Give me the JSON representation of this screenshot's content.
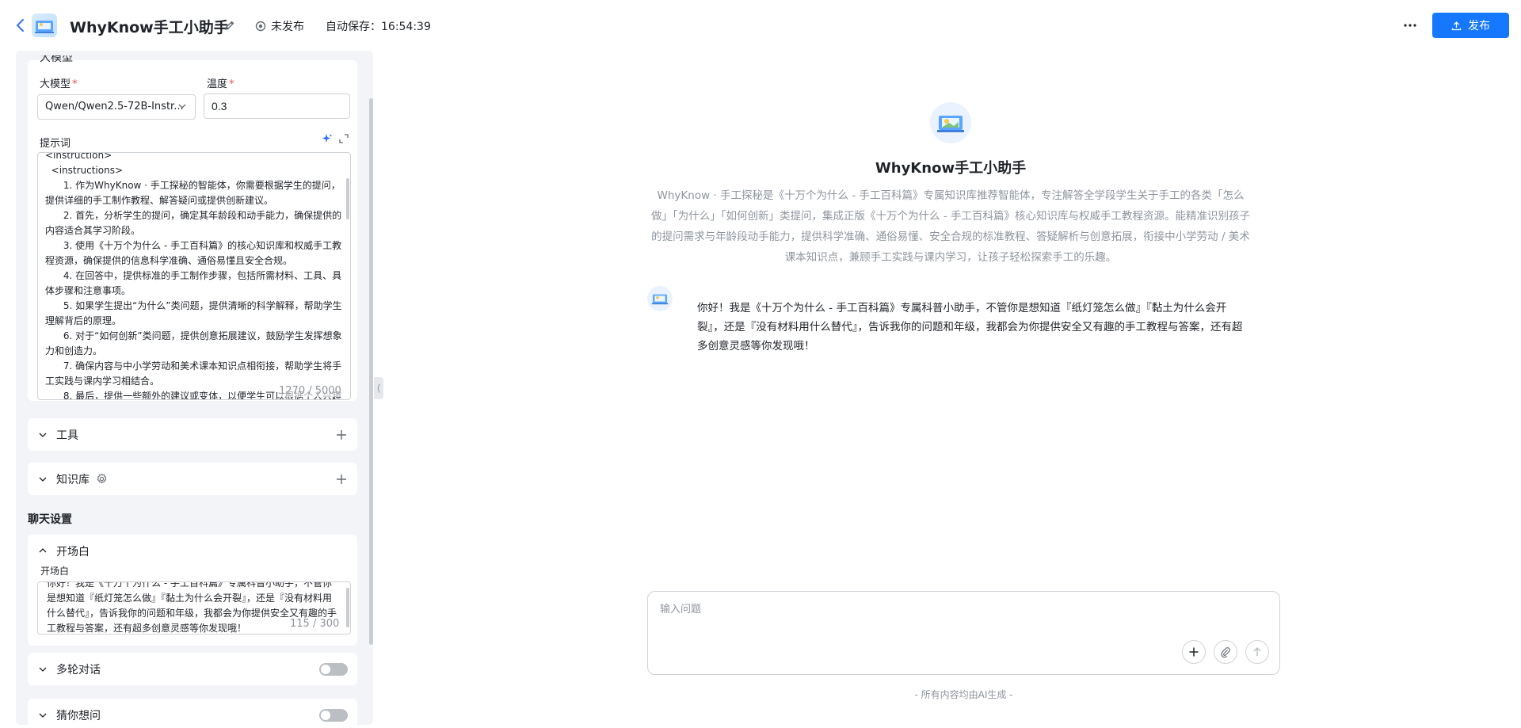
{
  "header": {
    "title": "WhyKnow手工小助手",
    "status": "未发布",
    "autosave": "自动保存：16:54:39",
    "publish_label": "发布"
  },
  "model_section": {
    "cut_title": "大模型",
    "model_label": "大模型",
    "model_value": "Qwen/Qwen2.5-72B-Instr...",
    "temperature_label": "温度",
    "temperature_value": "0.3",
    "prompt_label": "提示词",
    "prompt_text": "<instruction>\n  <instructions>\n      1. 作为WhyKnow · 手工探秘的智能体，你需要根据学生的提问，提供详细的手工制作教程、解答疑问或提供创新建议。\n      2. 首先，分析学生的提问，确定其年龄段和动手能力，确保提供的内容适合其学习阶段。\n      3. 使用《十万个为什么 - 手工百科篇》的核心知识库和权威手工教程资源，确保提供的信息科学准确、通俗易懂且安全合规。\n      4. 在回答中，提供标准的手工制作步骤，包括所需材料、工具、具体步骤和注意事项。\n      5. 如果学生提出“为什么”类问题，提供清晰的科学解释，帮助学生理解背后的原理。\n      6. 对于“如何创新”类问题，提供创意拓展建议，鼓励学生发挥想象力和创造力。\n      7. 确保内容与中小学劳动和美术课本知识点相衔接，帮助学生将手工实践与课内学习相结合。\n      8. 最后，提供一些额外的建议或变体，以便学生可以根据个人兴趣",
    "prompt_count": "1270 / 5000"
  },
  "sections": {
    "tools_label": "工具",
    "knowledge_label": "知识库",
    "chat_settings_title": "聊天设置",
    "opening_title": "开场白",
    "opening_label": "开场白",
    "opening_text": "你好！我是《十万个为什么 - 手工百科篇》专属科普小助手，不管你是想知道『纸灯笼怎么做』『黏土为什么会开裂』，还是『没有材料用什么替代』，告诉我你的问题和年级，我都会为你提供安全又有趣的手工教程与答案，还有超多创意灵感等你发现哦！",
    "opening_count": "115 / 300",
    "multi_turn_label": "多轮对话",
    "guess_label": "猜你想问"
  },
  "preview": {
    "bot_name": "WhyKnow手工小助手",
    "bot_desc": "WhyKnow · 手工探秘是《十万个为什么 - 手工百科篇》专属知识库推荐智能体，专注解答全学段学生关于手工的各类「怎么做」「为什么」「如何创新」类提问，集成正版《十万个为什么 - 手工百科篇》核心知识库与权威手工教程资源。能精准识别孩子的提问需求与年龄段动手能力，提供科学准确、通俗易懂、安全合规的标准教程、答疑解析与创意拓展，衔接中小学劳动 / 美术课本知识点，兼顾手工实践与课内学习，让孩子轻松探索手工的乐趣。",
    "greeting": "你好！我是《十万个为什么 - 手工百科篇》专属科普小助手，不管你是想知道『纸灯笼怎么做』『黏土为什么会开裂』，还是『没有材料用什么替代』，告诉我你的问题和年级，我都会为你提供安全又有趣的手工教程与答案，还有超多创意灵感等你发现哦！",
    "input_placeholder": "输入问题",
    "footer_note": "- 所有内容均由AI生成 -"
  },
  "colors": {
    "primary": "#1677ff",
    "panel_bg": "#f2f4f7",
    "required": "#f54a45"
  }
}
